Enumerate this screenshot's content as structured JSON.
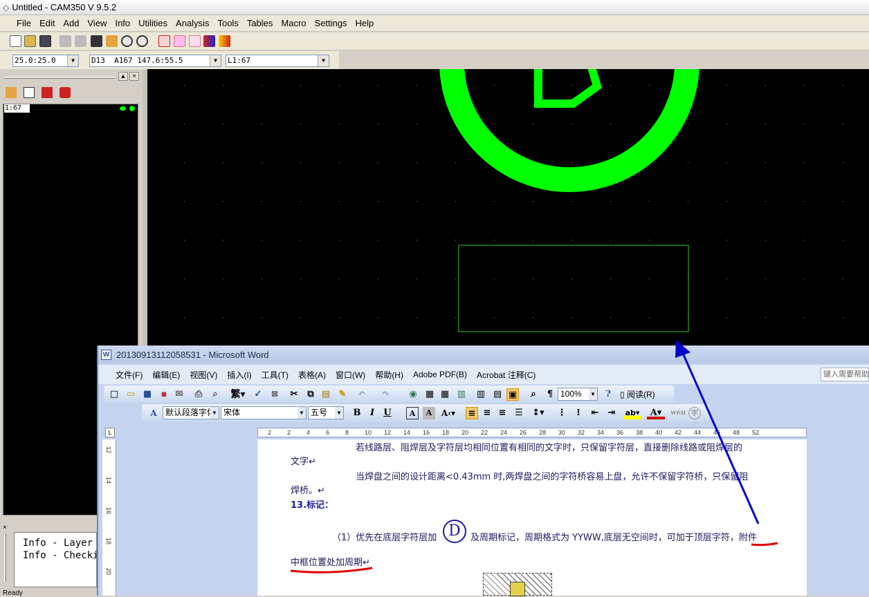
{
  "cam": {
    "title": "Untitled - CAM350 V 9.5.2",
    "menu": [
      "File",
      "Edit",
      "Add",
      "View",
      "Info",
      "Utilities",
      "Analysis",
      "Tools",
      "Tables",
      "Macro",
      "Settings",
      "Help"
    ],
    "combo_grid": "25.0:25.0",
    "combo_dcode": "D13  A167 147.6:55.5",
    "combo_layer": "L1:67",
    "layer_tag": "1:67",
    "info_lines": "Info - Layer\nInfo - Checki",
    "status": "Ready",
    "colors": {
      "canvas": "#000000",
      "pad": "#00ff00",
      "outline": "#33cc33"
    }
  },
  "word": {
    "title": "20130913112058531 - Microsoft Word",
    "menu": [
      "文件(F)",
      "编辑(E)",
      "视图(V)",
      "插入(I)",
      "工具(T)",
      "表格(A)",
      "窗口(W)",
      "帮助(H)",
      "Adobe PDF(B)",
      "Acrobat 注释(C)"
    ],
    "help_placeholder": "键入需要帮助",
    "zoom": "100%",
    "read_button": "阅读(R)",
    "style_combo": "默认段落字体",
    "font_combo": "宋体",
    "size_combo": "五号",
    "ruler_ticks": [
      "2",
      "2",
      "4",
      "6",
      "8",
      "10",
      "12",
      "14",
      "16",
      "18",
      "20",
      "22",
      "24",
      "26",
      "28",
      "30",
      "32",
      "34",
      "36",
      "38",
      "40",
      "42",
      "44",
      "46",
      "48",
      "52"
    ],
    "vruler_ticks": [
      "12",
      "14",
      "16",
      "18",
      "20"
    ],
    "doc": {
      "p1": "若线路层、阻焊层及字符层均相同位置有相同的文字时，只保留字符层，直接删除线路或阻焊层的",
      "p1b": "文字↵",
      "p2": "当焊盘之间的设计距离<0.43mm 时,两焊盘之间的字符桥容易上盘，允许不保留字符桥，只保留阻",
      "p2b": "焊桥。↵",
      "heading": "13.标记：",
      "p3a": "（1）优先在底层字符层加",
      "circle": "D",
      "p3b": "及周期标记，周期格式为 YYWW,底层无空间时，可加于顶层字符，附件",
      "p3c": "中框位置处加周期↵"
    }
  }
}
